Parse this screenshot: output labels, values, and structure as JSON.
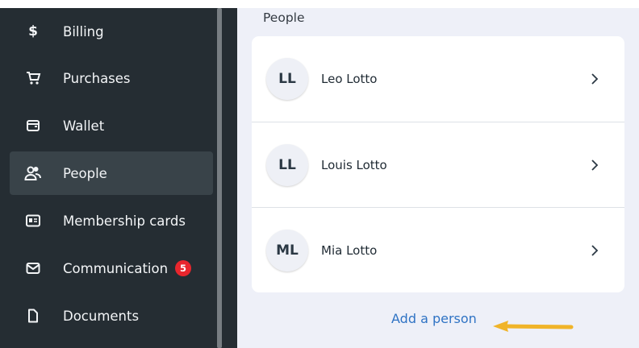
{
  "sidebar": {
    "items": [
      {
        "label": "Billing",
        "icon": "dollar-icon",
        "active": false
      },
      {
        "label": "Purchases",
        "icon": "cart-icon",
        "active": false
      },
      {
        "label": "Wallet",
        "icon": "wallet-icon",
        "active": false
      },
      {
        "label": "People",
        "icon": "people-icon",
        "active": true
      },
      {
        "label": "Membership cards",
        "icon": "id-card-icon",
        "active": false
      },
      {
        "label": "Communication",
        "icon": "envelope-icon",
        "active": false,
        "badge": "5"
      },
      {
        "label": "Documents",
        "icon": "document-icon",
        "active": false
      }
    ]
  },
  "main": {
    "section_title": "People",
    "people": [
      {
        "initials": "LL",
        "name": "Leo Lotto"
      },
      {
        "initials": "LL",
        "name": "Louis Lotto"
      },
      {
        "initials": "ML",
        "name": "Mia Lotto"
      }
    ],
    "add_person_label": "Add a person"
  },
  "colors": {
    "sidebar_bg": "#252d33",
    "sidebar_active": "#394349",
    "badge": "#e8262d",
    "link": "#2f73c4",
    "annotation_arrow": "#f0b429",
    "main_bg": "#eef0f8"
  }
}
